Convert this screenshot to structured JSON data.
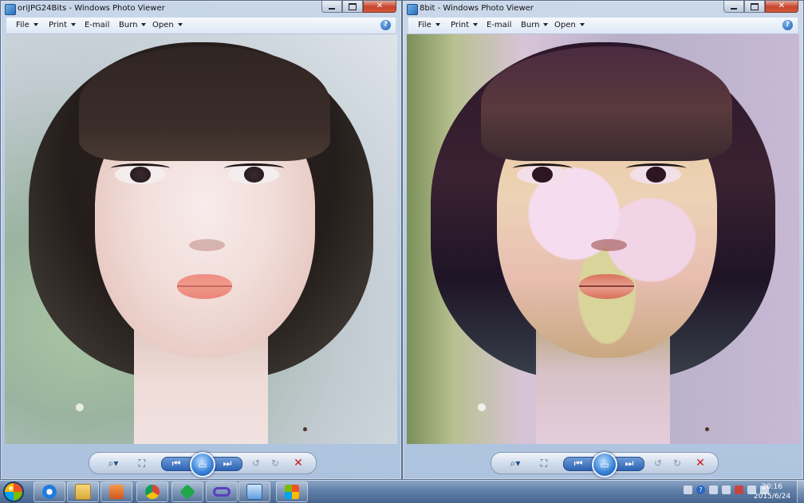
{
  "windows": [
    {
      "title": "oriJPG24Bits - Windows Photo Viewer",
      "caption_buttons": {
        "minimize": "—",
        "maximize": "□",
        "close": "✕"
      },
      "menu": {
        "file": "File",
        "print": "Print",
        "email": "E-mail",
        "burn": "Burn",
        "open": "Open"
      },
      "help": "?"
    },
    {
      "title": "8bit - Windows Photo Viewer",
      "caption_buttons": {
        "minimize": "—",
        "maximize": "□",
        "close": "✕"
      },
      "menu": {
        "file": "File",
        "print": "Print",
        "email": "E-mail",
        "burn": "Burn",
        "open": "Open"
      },
      "help": "?"
    }
  ],
  "controls": {
    "zoom": "⌕▾",
    "fit": "⛶",
    "prev": "⏮",
    "slideshow": "▭",
    "next": "⏭",
    "rotate_left": "↺",
    "rotate_right": "↻",
    "delete": "✕"
  },
  "taskbar": {
    "icons": [
      "ie-icon",
      "folder-icon",
      "media-player-icon",
      "chrome-icon",
      "green-app-icon",
      "infinity-app-icon",
      "photo-viewer-icon",
      "office-app-icon"
    ],
    "clock_time": "20:16",
    "clock_date": "2015/6/24"
  },
  "colors": {
    "title_text": "#111111",
    "close_button": "#c7452b",
    "taskbar": "#5f7fa8"
  }
}
